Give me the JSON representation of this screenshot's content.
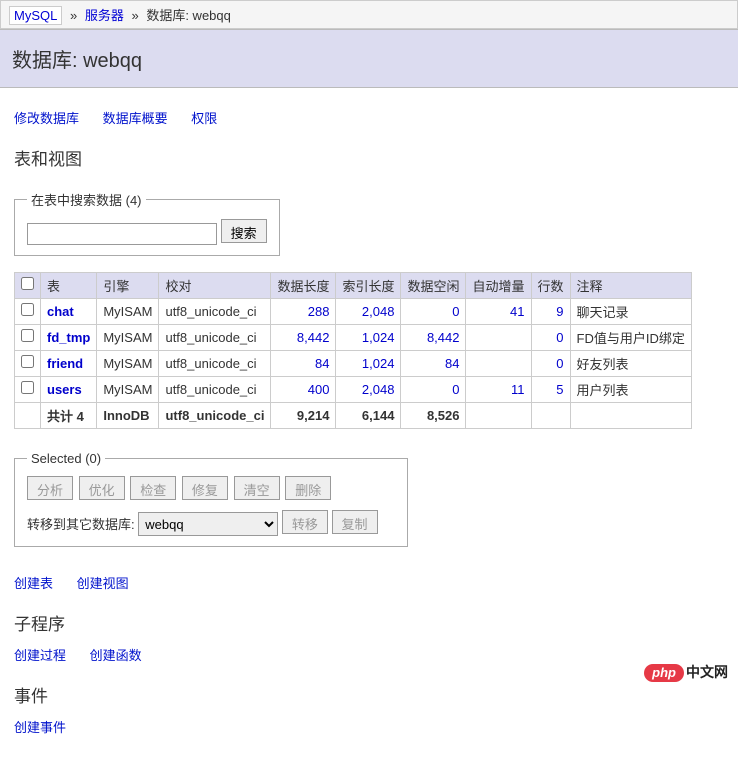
{
  "breadcrumb": {
    "mysql": "MySQL",
    "server": "服务器",
    "database_label": "数据库: webqq"
  },
  "header": {
    "title": "数据库: webqq"
  },
  "top_links": {
    "alter_db": "修改数据库",
    "db_schema": "数据库概要",
    "privileges": "权限"
  },
  "tables_section": {
    "heading": "表和视图",
    "fieldset_legend": "在表中搜索数据 (4)",
    "search_btn": "搜索"
  },
  "table": {
    "headers": {
      "table": "表",
      "engine": "引擎",
      "collation": "校对",
      "data_len": "数据长度",
      "index_len": "索引长度",
      "data_free": "数据空闲",
      "auto_incr": "自动增量",
      "rows": "行数",
      "comment": "注释"
    },
    "rows": [
      {
        "name": "chat",
        "engine": "MyISAM",
        "collation": "utf8_unicode_ci",
        "data_len": "288",
        "index_len": "2,048",
        "data_free": "0",
        "auto_incr": "41",
        "rows": "9",
        "comment": "聊天记录"
      },
      {
        "name": "fd_tmp",
        "engine": "MyISAM",
        "collation": "utf8_unicode_ci",
        "data_len": "8,442",
        "index_len": "1,024",
        "data_free": "8,442",
        "auto_incr": "",
        "rows": "0",
        "comment": "FD值与用户ID绑定"
      },
      {
        "name": "friend",
        "engine": "MyISAM",
        "collation": "utf8_unicode_ci",
        "data_len": "84",
        "index_len": "1,024",
        "data_free": "84",
        "auto_incr": "",
        "rows": "0",
        "comment": "好友列表"
      },
      {
        "name": "users",
        "engine": "MyISAM",
        "collation": "utf8_unicode_ci",
        "data_len": "400",
        "index_len": "2,048",
        "data_free": "0",
        "auto_incr": "11",
        "rows": "5",
        "comment": "用户列表"
      }
    ],
    "footer": {
      "label": "共计 4",
      "engine": "InnoDB",
      "collation": "utf8_unicode_ci",
      "data_len": "9,214",
      "index_len": "6,144",
      "data_free": "8,526"
    }
  },
  "selected": {
    "legend": "Selected (0)",
    "analyze": "分析",
    "optimize": "优化",
    "check": "检查",
    "repair": "修复",
    "truncate": "清空",
    "drop": "删除",
    "move_label": "转移到其它数据库:",
    "move_value": "webqq",
    "move_btn": "转移",
    "copy_btn": "复制"
  },
  "create_links": {
    "create_table": "创建表",
    "create_view": "创建视图"
  },
  "routines": {
    "heading": "子程序",
    "create_proc": "创建过程",
    "create_func": "创建函数"
  },
  "events": {
    "heading": "事件",
    "create_event": "创建事件"
  },
  "logo": {
    "php": "php",
    "cn": "中文网"
  }
}
